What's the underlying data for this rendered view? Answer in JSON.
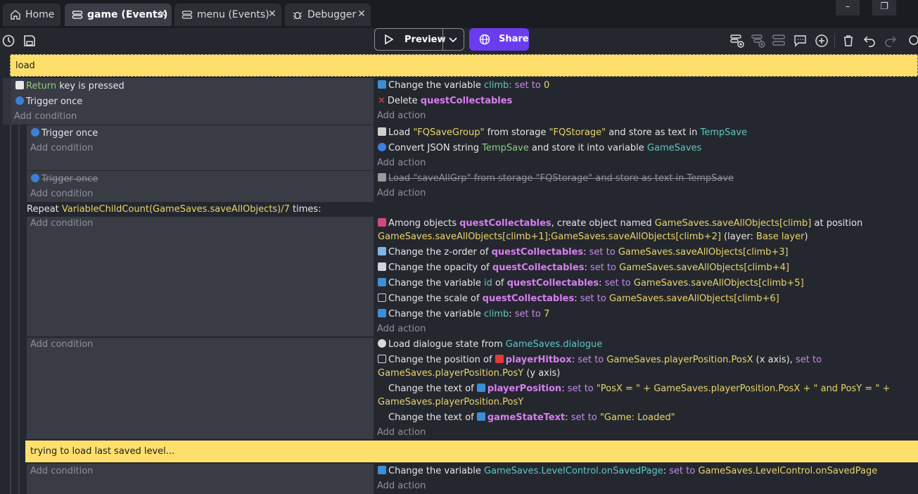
{
  "tabs": [
    {
      "label": "Home",
      "icon": "home-icon"
    },
    {
      "label": "game (Events)",
      "icon": "events-icon"
    },
    {
      "label": "menu (Events)",
      "icon": "events-icon"
    },
    {
      "label": "Debugger",
      "icon": "debugger-icon"
    }
  ],
  "window": {
    "minimize": "–",
    "restore": "❐"
  },
  "toolbar": {
    "preview": "Preview",
    "share": "Share"
  },
  "common": {
    "add_condition": "Add condition",
    "add_action": "Add action",
    "trigger_once": "Trigger once"
  },
  "comments": {
    "load": "load",
    "trying": "trying to load last saved level..."
  },
  "ev1": {
    "cond_key": "Return",
    "cond_key_rest": " key is pressed",
    "a1_pre": "Change the variable ",
    "a1_var": "climb",
    "a1_mid": ": set to ",
    "a1_val": "0",
    "a2_pre": "Delete ",
    "a2_obj": "questCollectables"
  },
  "ev2": {
    "a1_pre": "Load ",
    "a1_grp": "\"FQSaveGroup\"",
    "a1_mid": " from storage ",
    "a1_st": "\"FQStorage\"",
    "a1_mid2": " and store as text in ",
    "a1_var": "TempSave",
    "a2_pre": "Convert JSON string ",
    "a2_var": "TempSave",
    "a2_mid": " and store it into variable ",
    "a2_target": "GameSaves"
  },
  "ev3": {
    "a1_pre": "Load ",
    "a1_grp": "\"saveAllGrp\"",
    "a1_mid": " from storage ",
    "a1_st": "\"FQStorage\"",
    "a1_mid2": " and store as text in ",
    "a1_var": "TempSave"
  },
  "repeat": {
    "pre": "Repeat ",
    "expr": "VariableChildCount(GameSaves.saveAllObjects)/7",
    "post": " times:"
  },
  "ev4": {
    "a1_pre": "Among objects ",
    "a1_obj": "questCollectables",
    "a1_mid": ", create object named ",
    "a1_name": "GameSaves.saveAllObjects[climb]",
    "a1_mid2": " at position",
    "a1_pos": "GameSaves.saveAllObjects[climb+1];GameSaves.saveAllObjects[climb+2]",
    "a1_layer_pre": " (layer: ",
    "a1_layer": "Base layer",
    "a1_layer_post": ")",
    "a2_pre": "Change the z-order of ",
    "a2_obj": "questCollectables",
    "a2_mid": ": ",
    "a2_set": "set to",
    "a2_val": "GameSaves.saveAllObjects[climb+3]",
    "a3_pre": "Change the opacity of ",
    "a3_obj": "questCollectables",
    "a3_mid": ": ",
    "a3_set": "set to",
    "a3_val": "GameSaves.saveAllObjects[climb+4]",
    "a4_pre": "Change the variable ",
    "a4_var": "id",
    "a4_mid": " of ",
    "a4_obj": "questCollectables",
    "a4_mid2": ": ",
    "a4_set": "set to",
    "a4_val": "GameSaves.saveAllObjects[climb+5]",
    "a5_pre": "Change the scale of ",
    "a5_obj": "questCollectables",
    "a5_mid": ": ",
    "a5_set": "set to",
    "a5_val": "GameSaves.saveAllObjects[climb+6]",
    "a6_pre": "Change the variable ",
    "a6_var": "climb",
    "a6_mid": ": ",
    "a6_set": "set to",
    "a6_val": "7"
  },
  "ev5": {
    "a1_pre": "Load dialogue state from ",
    "a1_var": "GameSaves.dialogue",
    "a2_pre": "Change the position of ",
    "a2_obj": "playerHitbox",
    "a2_mid": ": ",
    "a2_set": "set to",
    "a2_val": "GameSaves.playerPosition.PosX",
    "a2_mid2": " (x axis), ",
    "a2_set2": "set to",
    "a2_val2": "GameSaves.playerPosition.PosY",
    "a2_post": " (y axis)",
    "a3_pre": "Change the text of ",
    "a3_obj": "playerPosition",
    "a3_mid": ": ",
    "a3_set": "set to",
    "a3_val": "\"PosX = \" + GameSaves.playerPosition.PosX + \" and PosY = \" +",
    "a3_val2": "GameSaves.playerPosition.PosY",
    "a4_pre": "Change the text of ",
    "a4_obj": "gameStateText",
    "a4_mid": ": ",
    "a4_set": "set to",
    "a4_val": "\"Game: Loaded\""
  },
  "ev6": {
    "a1_pre": "Change the variable ",
    "a1_var": "GameSaves.LevelControl.onSavedPage",
    "a1_mid": ": ",
    "a1_set": "set to",
    "a1_val": "GameSaves.LevelControl.onSavedPage"
  },
  "colors": {
    "accent": "#6a3cf0",
    "comment": "#fedf6c",
    "condition_bg": "#393b45",
    "background": "#25272f"
  }
}
